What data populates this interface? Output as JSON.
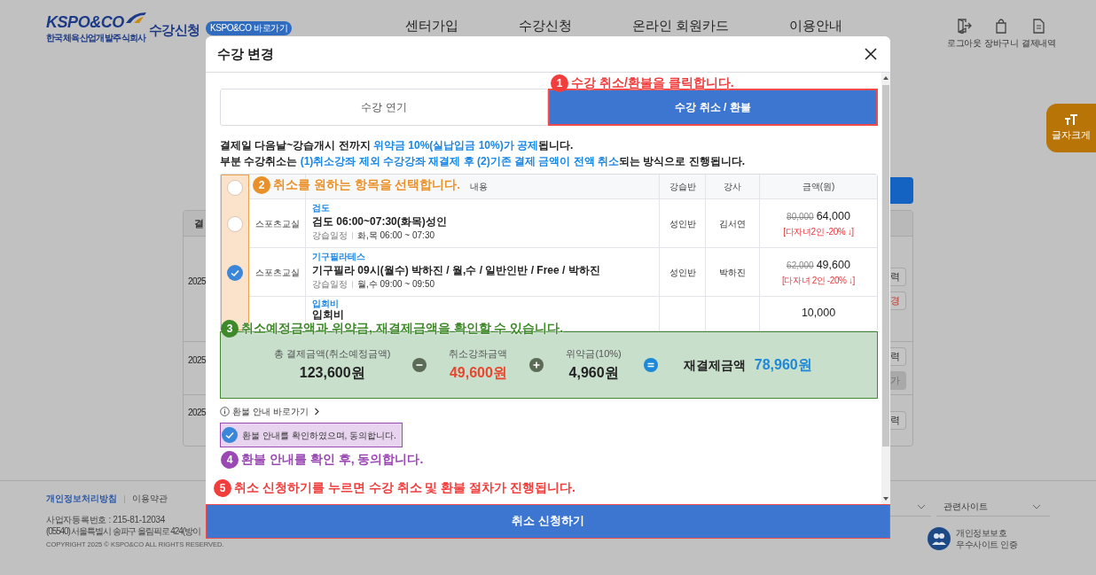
{
  "header": {
    "logo_wordmark": "KSPO&CO",
    "logo_company": "한국체육산업개발주식회사",
    "site_title": "수강신청",
    "shortcut_badge": "KSPO&CO 바로가기",
    "nav": [
      "센터가입",
      "수강신청",
      "온라인 회원카드",
      "이용안내"
    ],
    "utilities": [
      {
        "label": "로그아웃",
        "kind": "logout"
      },
      {
        "label": "장바구니",
        "kind": "cart"
      },
      {
        "label": "결제내역",
        "kind": "receipt"
      }
    ]
  },
  "font_size_button": {
    "label": "글자크게"
  },
  "background_table": {
    "header_fragment": "결",
    "rows": [
      {
        "date_fragment": "2025",
        "buttons": [
          {
            "label": "력",
            "kind": "outline"
          },
          {
            "label": "경",
            "kind": "danger"
          }
        ]
      },
      {
        "date_fragment": "2025",
        "buttons": [
          {
            "label": "력",
            "kind": "outline"
          },
          {
            "label": "가",
            "kind": "disabled"
          }
        ]
      },
      {
        "date_fragment": "2025",
        "buttons": [
          {
            "label": "력",
            "kind": "outline"
          }
        ]
      }
    ]
  },
  "footer": {
    "links": [
      {
        "label": "개인정보처리방침",
        "kind": "emphasis"
      },
      {
        "label": "이용약관",
        "kind": "plain"
      }
    ],
    "business_no": "사업자등록번호 : 215-81-12034",
    "address": "(05540) 서울특별시 송파구 올림픽로 424(방이",
    "copyright": "COPYRIGHT 2025 © KSPO&CO ALL RIGHTS RESERVED.",
    "dropdowns": [
      {
        "kind": "cut"
      },
      {
        "kind": "full",
        "label": "관련사이트"
      }
    ],
    "certification": [
      "개인정보보호",
      "우수사이트 인증"
    ]
  },
  "modal": {
    "title": "수강 변경",
    "tabs": [
      {
        "label": "수강 연기",
        "selected": false
      },
      {
        "label": "수강 취소 / 환불",
        "selected": true
      }
    ],
    "notice": [
      "결제일 다음날~강습개시 전까지 **위약금 10%(실납입금 10%)가 공제**됩니다.",
      "부분 수강취소는 **(1)취소강좌 제외 수강강좌 재결제 후 (2)기존 결제 금액이 전액 취소**되는 방식으로 진행됩니다."
    ],
    "table": {
      "header_checked": false,
      "columns": [
        "내용",
        "강습반",
        "강사",
        "금액(원)"
      ],
      "rows": [
        {
          "kind": "course",
          "checked": false,
          "place": "스포츠교실",
          "category": "검도",
          "title": "검도 06:00~07:30(화목)성인",
          "schedule_label": "강습일정",
          "schedule": "화,목 06:00 ~ 07:30",
          "class": "성인반",
          "instructor": "김서연",
          "original_price": "80,000",
          "price": "64,000",
          "discount": "[다자녀2인 -20% ↓]"
        },
        {
          "kind": "course",
          "checked": true,
          "place": "스포츠교실",
          "category": "기구필라테스",
          "title": "기구필라 09시(월수) 박하진 / 월,수 / 일반인반 / Free / 박하진",
          "schedule_label": "강습일정",
          "schedule": "월,수 09:00 ~ 09:50",
          "class": "성인반",
          "instructor": "박하진",
          "original_price": "62,000",
          "price": "49,600",
          "discount": "[다자녀 2인 -20% ↓]"
        },
        {
          "kind": "fee",
          "category": "입회비",
          "title": "입회비",
          "price": "10,000"
        }
      ]
    },
    "summary": [
      {
        "label": "총 결제금액(취소예정금액)",
        "amount": "123,600원",
        "kind": "total"
      },
      {
        "kind": "minus"
      },
      {
        "label": "취소강좌금액",
        "amount": "49,600원",
        "kind": "cancel"
      },
      {
        "kind": "plus"
      },
      {
        "label": "위약금(10%)",
        "amount": "4,960원",
        "kind": "penalty"
      },
      {
        "kind": "equals"
      },
      {
        "label": "재결제금액",
        "amount": "78,960원",
        "kind": "result"
      }
    ],
    "refund_link": "환불 안내 바로가기",
    "agreement": {
      "label": "환불 안내를 확인하였으며, 동의합니다.",
      "checked": true
    },
    "submit": "취소 신청하기"
  },
  "annotations": [
    {
      "number": "1",
      "text": "수강 취소/환불을 클릭합니다.",
      "color": "#f23d3d"
    },
    {
      "number": "2",
      "text": "취소를 원하는 항목을 선택합니다.",
      "color": "#e8902a"
    },
    {
      "number": "3",
      "text": "취소예정금액과 위약금, 재결제금액을 확인할 수 있습니다.",
      "color": "#3e8a2a"
    },
    {
      "number": "4",
      "text": "환불 안내를 확인 후, 동의합니다.",
      "color": "#9a48b4"
    },
    {
      "number": "5",
      "text": "취소 신청하기를 누르면 수강 취소 및 환불 절차가 진행됩니다.",
      "color": "#f23d3d"
    }
  ]
}
